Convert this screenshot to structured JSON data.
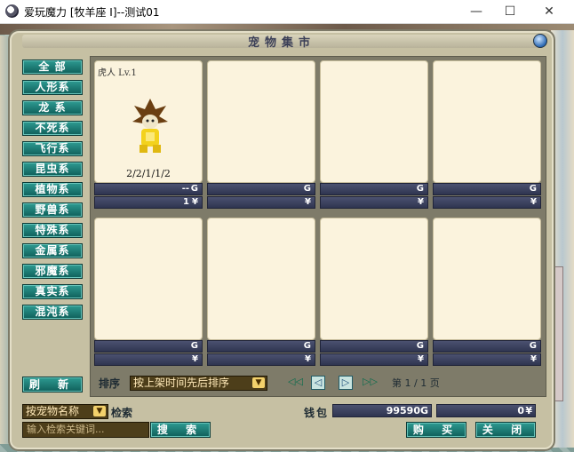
{
  "window": {
    "title": "爱玩魔力 [牧羊座 I]--测试01",
    "minimize": "—",
    "maximize": "☐",
    "close": "✕"
  },
  "panel": {
    "title": "宠物集市"
  },
  "categories": [
    {
      "label": "全 部"
    },
    {
      "label": "人形系"
    },
    {
      "label": "龙 系"
    },
    {
      "label": "不死系"
    },
    {
      "label": "飞行系"
    },
    {
      "label": "昆虫系"
    },
    {
      "label": "植物系"
    },
    {
      "label": "野兽系"
    },
    {
      "label": "特殊系"
    },
    {
      "label": "金属系"
    },
    {
      "label": "邪魔系"
    },
    {
      "label": "真实系"
    },
    {
      "label": "混沌系"
    }
  ],
  "refresh_label": "刷 新",
  "slots": [
    {
      "name": "虎人 Lv.1",
      "stats": "2/2/1/1/2",
      "g_value": "--",
      "g_unit": "G",
      "y_value": "1",
      "y_unit": "¥"
    },
    {
      "name": "",
      "stats": "",
      "g_value": "",
      "g_unit": "G",
      "y_value": "",
      "y_unit": "¥"
    },
    {
      "name": "",
      "stats": "",
      "g_value": "",
      "g_unit": "G",
      "y_value": "",
      "y_unit": "¥"
    },
    {
      "name": "",
      "stats": "",
      "g_value": "",
      "g_unit": "G",
      "y_value": "",
      "y_unit": "¥"
    },
    {
      "name": "",
      "stats": "",
      "g_value": "",
      "g_unit": "G",
      "y_value": "",
      "y_unit": "¥"
    },
    {
      "name": "",
      "stats": "",
      "g_value": "",
      "g_unit": "G",
      "y_value": "",
      "y_unit": "¥"
    },
    {
      "name": "",
      "stats": "",
      "g_value": "",
      "g_unit": "G",
      "y_value": "",
      "y_unit": "¥"
    },
    {
      "name": "",
      "stats": "",
      "g_value": "",
      "g_unit": "G",
      "y_value": "",
      "y_unit": "¥"
    }
  ],
  "sort": {
    "label": "排序",
    "value": "按上架时间先后排序",
    "arrow": "▼"
  },
  "pager": {
    "first": "◁◁",
    "prev": "◁",
    "next": "▷",
    "last": "▷▷",
    "text": "第 1 / 1 页"
  },
  "search": {
    "mode": "按宠物名称",
    "arrow": "▼",
    "label": "检索",
    "placeholder": "输入检索关键词...",
    "button": "搜 索"
  },
  "wallet": {
    "label": "钱包",
    "gold": "99590",
    "gold_unit": "G",
    "yuan": "0",
    "yuan_unit": "¥"
  },
  "buttons": {
    "buy": "购 买",
    "close": "关 闭"
  },
  "colors": {
    "accent_teal": "#0f5f5a",
    "slot_bg": "#fbf3dd",
    "bar_navy": "#2f3550"
  }
}
